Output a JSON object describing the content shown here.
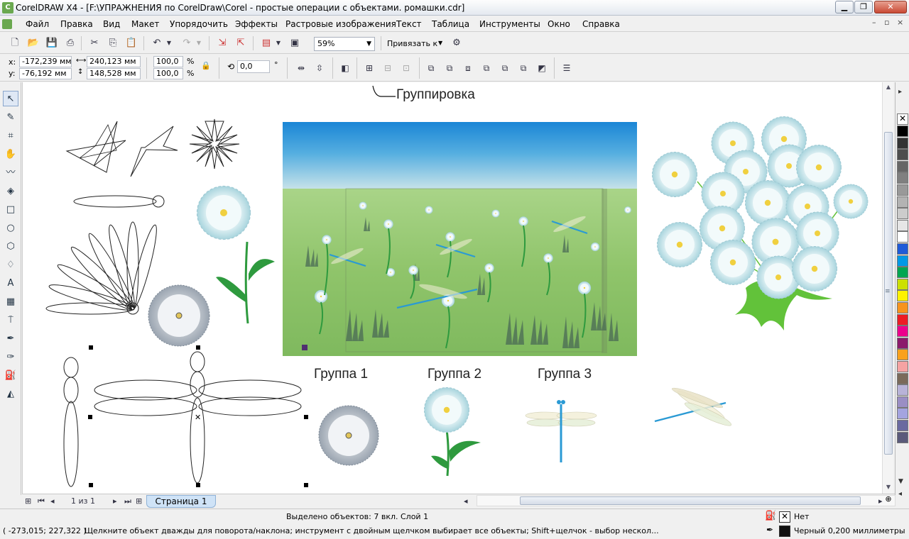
{
  "window": {
    "title": "CorelDRAW X4 - [F:\\УПРАЖНЕНИЯ по CorelDraw\\Corel - простые операции с объектами. ромашки.cdr]",
    "app_icon": "coreldraw-logo-icon",
    "controls": [
      "minimize-icon",
      "restore-icon",
      "close-icon"
    ]
  },
  "menu": {
    "items": [
      "Файл",
      "Правка",
      "Вид",
      "Макет",
      "Упорядочить",
      "Эффекты",
      "Растровые изображения",
      "Текст",
      "Таблица",
      "Инструменты",
      "Окно",
      "Справка"
    ]
  },
  "toolbar1": {
    "zoom_value": "59%",
    "snap_label": "Привязать к"
  },
  "toolbar2": {
    "x_label": "x:",
    "y_label": "y:",
    "x_value": "-172,239 мм",
    "y_value": "-76,192 мм",
    "width_value": "240,123 мм",
    "height_value": "148,528 мм",
    "scale_x": "100,0",
    "scale_y": "100,0",
    "percent": "%",
    "rotation": "0,0",
    "degree": "°"
  },
  "canvas": {
    "callout_label": "Группировка",
    "group_labels": [
      "Группа 1",
      "Группа 2",
      "Группа 3"
    ],
    "colors": {
      "sky_top": "#1a86d6",
      "sky_bottom": "#cfe6ea",
      "meadow": "#8fc46a",
      "leaf": "#2e9a3e",
      "dragonfly": "#2a9ad4",
      "petal": "#d4ebf0"
    }
  },
  "pagebar": {
    "page_counter": "1 из 1",
    "page_tab": "Страница 1"
  },
  "status": {
    "selection": "Выделено объектов: 7 вкл. Слой 1",
    "coords": "( -273,015; 227,322 )",
    "hint": "Щелкните объект дважды для поворота/наклона; инструмент с двойным щелчком выбирает все объекты; Shift+щелчок - выбор нескол...",
    "fill_label": "Нет",
    "outline_label": "Черный  0,200 миллиметры"
  },
  "palette": {
    "colors": [
      "#000000",
      "#333333",
      "#4d4d4d",
      "#666666",
      "#808080",
      "#999999",
      "#b3b3b3",
      "#cccccc",
      "#e6e6e6",
      "#ffffff",
      "#1f5bd8",
      "#0099e6",
      "#00a651",
      "#cce000",
      "#fff200",
      "#f7941d",
      "#ed1c24",
      "#ec008c",
      "#8b1a6b",
      "#f9a11b",
      "#f5a3a3",
      "#7a6a5a",
      "#b8b3d8",
      "#9a8ec4",
      "#a4a4e0",
      "#6a6aa0",
      "#5a5a7a"
    ]
  }
}
